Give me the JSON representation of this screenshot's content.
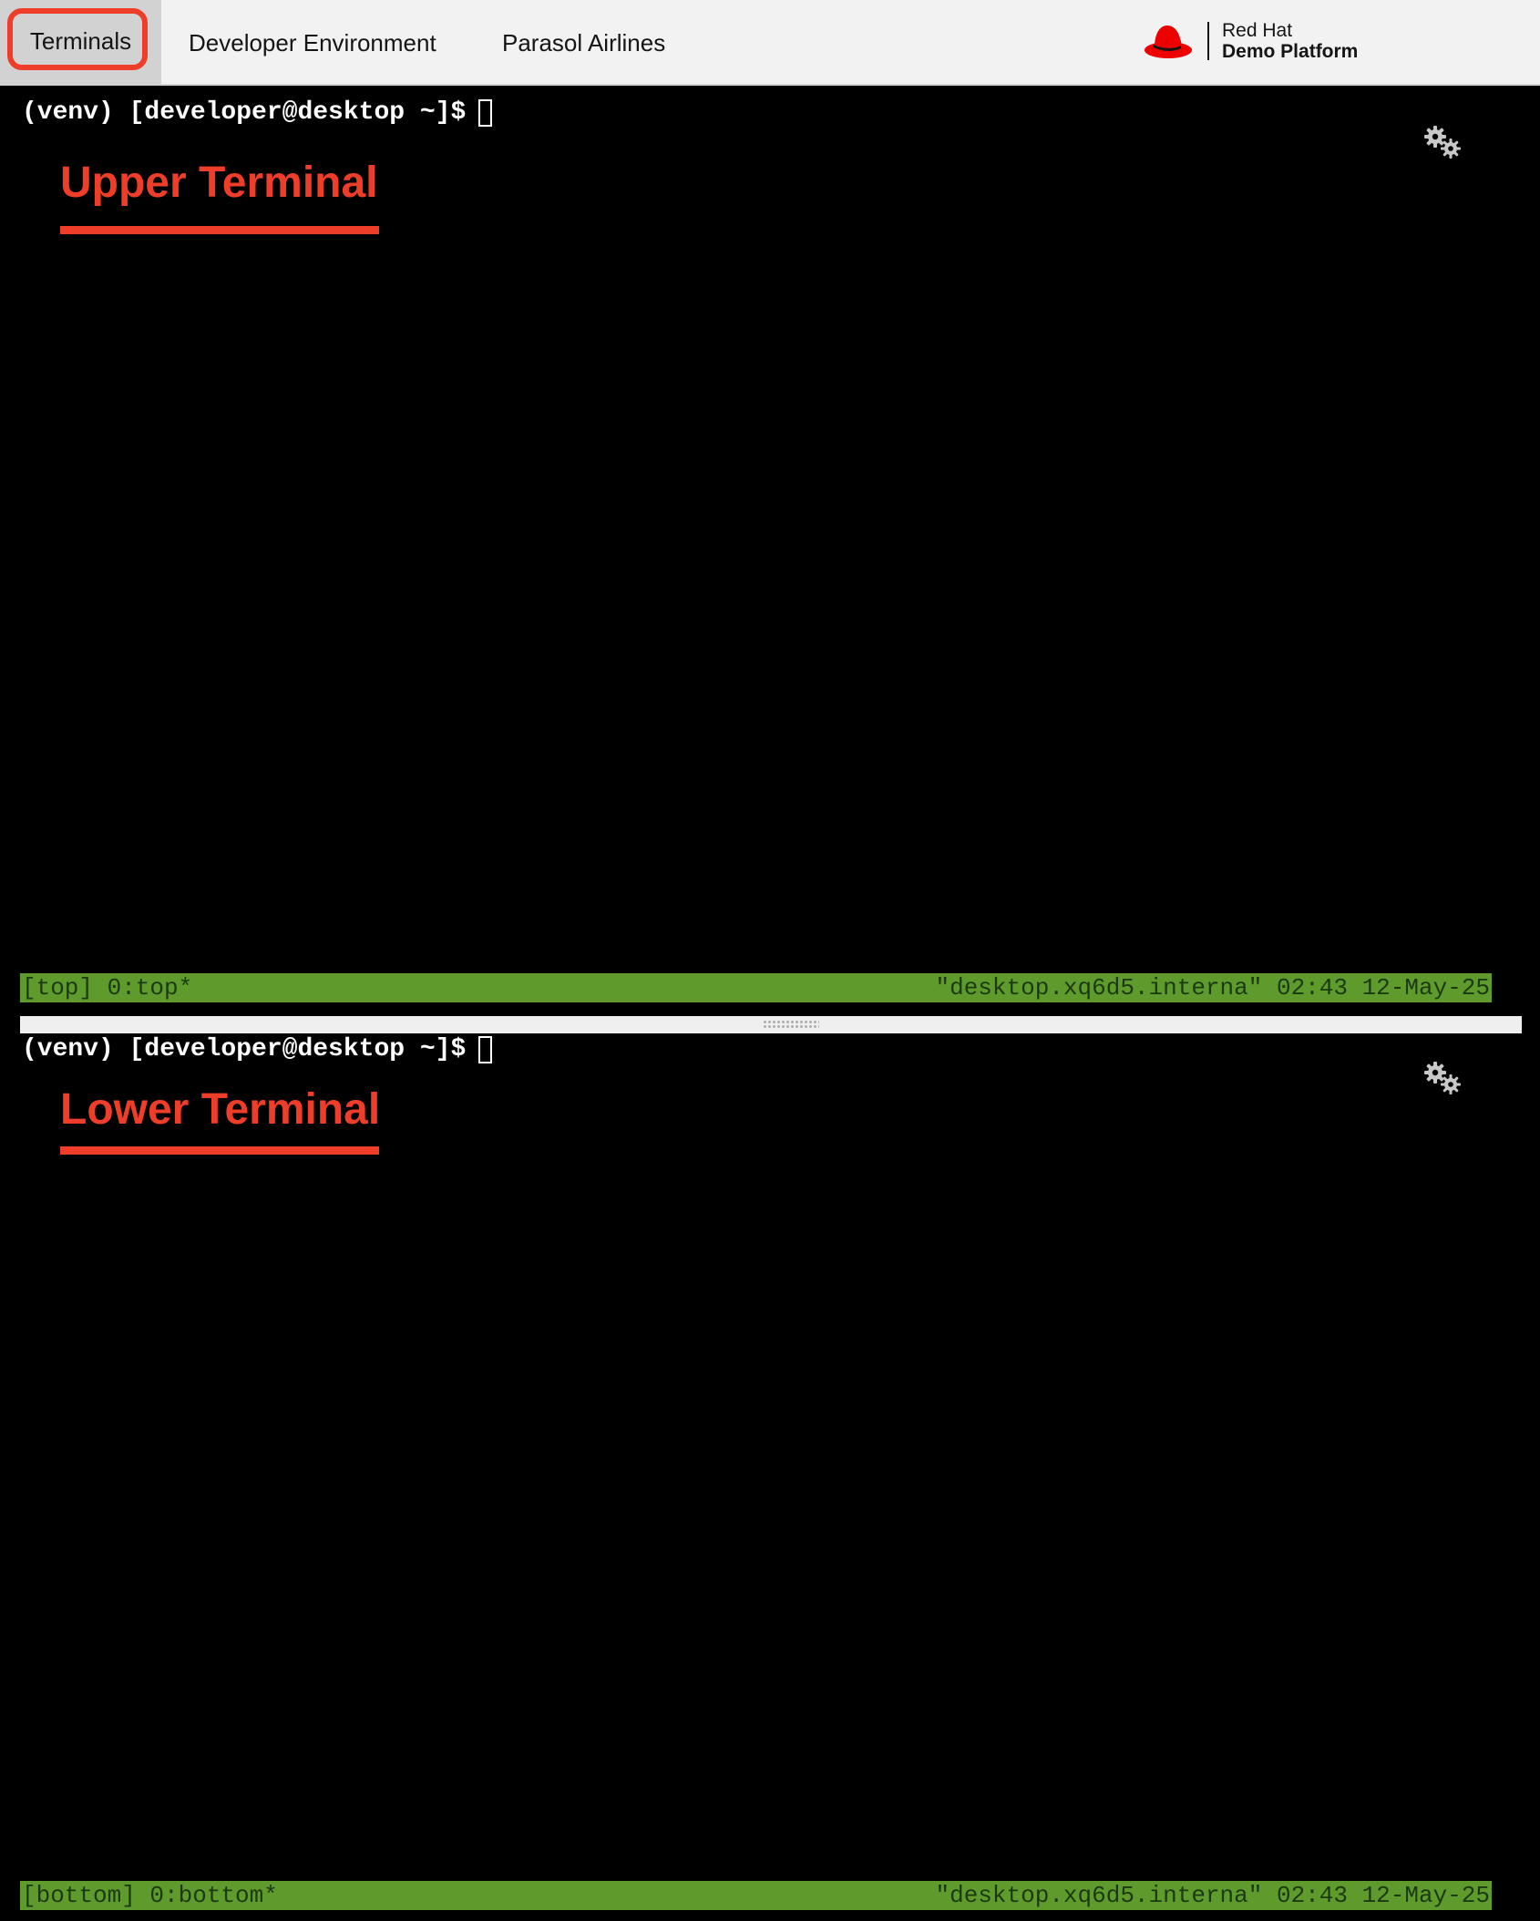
{
  "nav": {
    "tabs": [
      {
        "label": "Terminals",
        "active": true
      },
      {
        "label": "Developer Environment",
        "active": false
      },
      {
        "label": "Parasol Airlines",
        "active": false
      }
    ],
    "logo": {
      "line1": "Red Hat",
      "line2": "Demo Platform",
      "icon": "red-hat-fedora-icon"
    }
  },
  "panes": {
    "upper": {
      "prompt": "(venv) [developer@desktop ~]$",
      "title": "Upper Terminal",
      "settings_icon": "gears-icon",
      "status_left": "[top] 0:top*",
      "status_right": "\"desktop.xq6d5.interna\" 02:43 12-May-25"
    },
    "lower": {
      "prompt": "(venv) [developer@desktop ~]$",
      "title": "Lower Terminal",
      "settings_icon": "gears-icon",
      "status_left": "[bottom] 0:bottom*",
      "status_right": "\"desktop.xq6d5.interna\" 02:43 12-May-25"
    }
  },
  "colors": {
    "accent": "#ee3e2a",
    "nav_bg": "#f2f2f2",
    "active_tab_bg": "#d2d2d2",
    "terminal_bg": "#000000",
    "status_bar_bg": "#5f9a2d",
    "status_bar_text": "#1c3a12"
  }
}
